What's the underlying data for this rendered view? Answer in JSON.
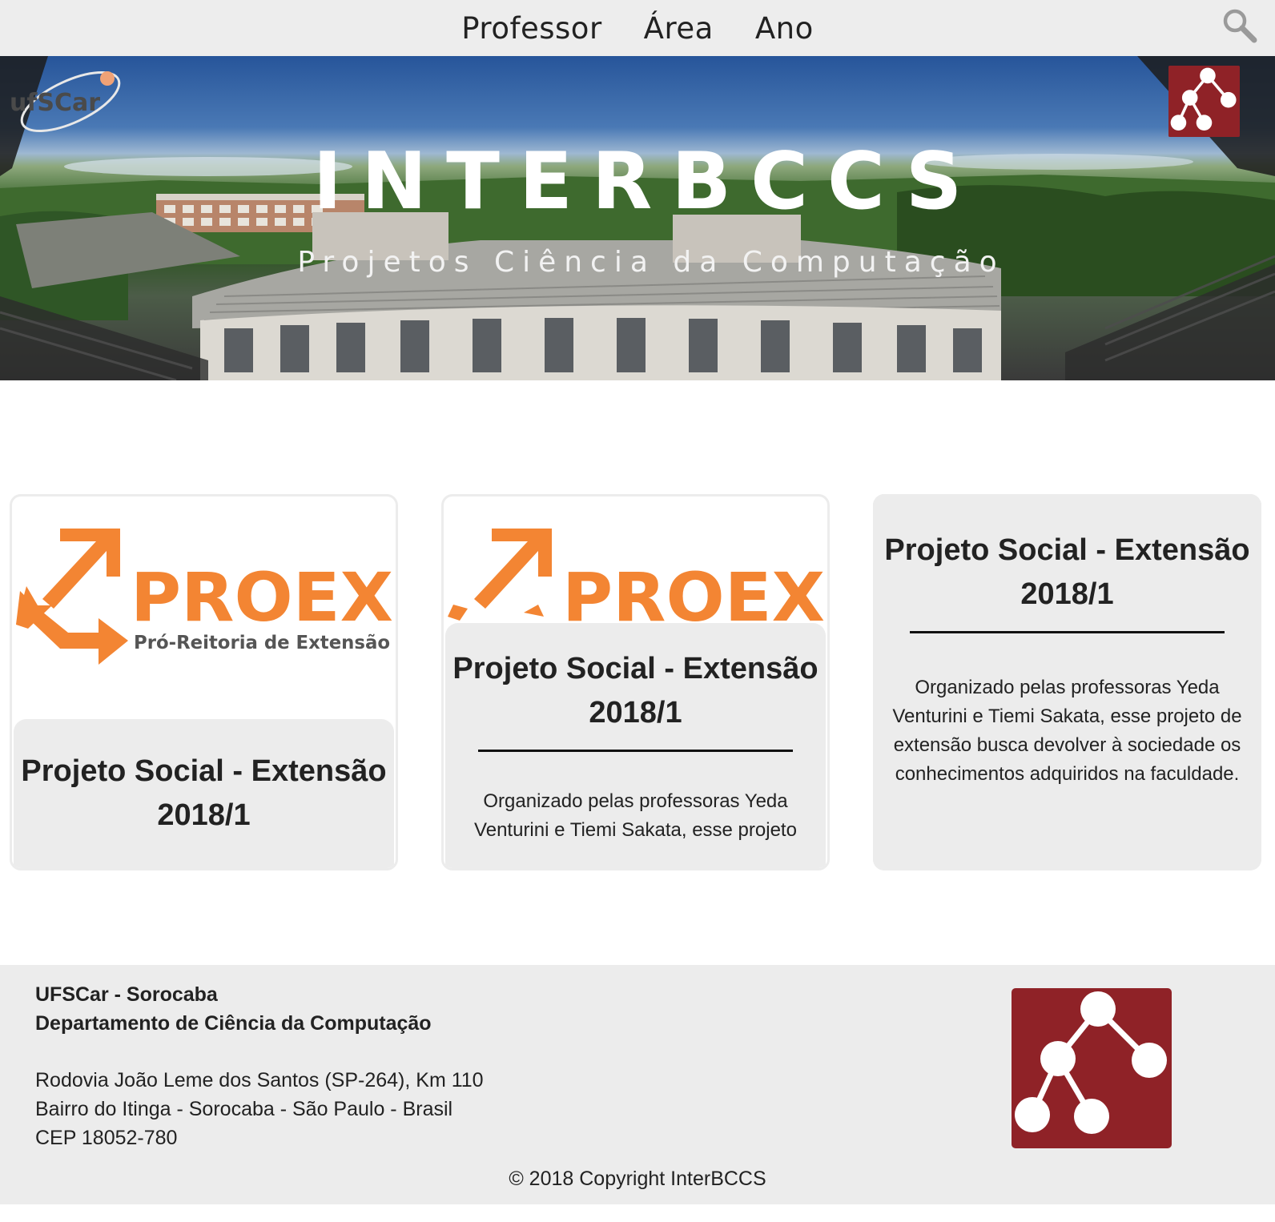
{
  "nav": {
    "items": [
      {
        "label": "Professor"
      },
      {
        "label": "Área"
      },
      {
        "label": "Ano"
      }
    ],
    "search_icon": "search-icon"
  },
  "hero": {
    "title": "INTERBCCS",
    "subtitle": "Projetos Ciência da Computação",
    "logo_text": "ufSCar",
    "emblem_icon": "tree-graph-icon"
  },
  "cards": [
    {
      "logo_text": "PROEX",
      "logo_subtext": "Pró-Reitoria de Extensão",
      "title": "Projeto Social - Extensão 2018/1"
    },
    {
      "logo_text": "PROEX",
      "title": "Projeto Social - Extensão 2018/1",
      "description": "Organizado pelas professoras Yeda Venturini e Tiemi Sakata, esse projeto"
    },
    {
      "title": "Projeto Social - Extensão 2018/1",
      "description": "Organizado pelas professoras Yeda Venturini e Tiemi Sakata, esse projeto de extensão busca devolver à sociedade os conhecimentos adquiridos na faculdade."
    }
  ],
  "footer": {
    "institution": "UFSCar - Sorocaba",
    "department": "Departamento de Ciência da Computação",
    "address_line1": "Rodovia João Leme dos Santos (SP-264), Km 110",
    "address_line2": "Bairro do Itinga - Sorocaba - São Paulo - Brasil",
    "cep": "CEP 18052-780",
    "copyright": "© 2018 Copyright InterBCCS"
  },
  "colors": {
    "nav_bg": "#ededed",
    "emblem_red": "#8f2227",
    "proex_orange": "#f38533",
    "proex_gray": "#555555",
    "panel_gray": "#ececec"
  }
}
